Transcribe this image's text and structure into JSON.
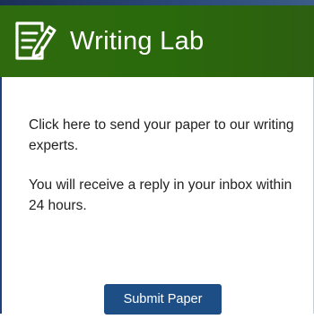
{
  "widget": {
    "title": "Writing Lab",
    "icon": "edit-document-icon",
    "paragraph_1": "Click here to send your paper to our writing experts.",
    "paragraph_2": "You will receive a reply in your inbox within 24 hours.",
    "submit_label": "Submit Paper"
  },
  "colors": {
    "header_bg": "#2f6b0e",
    "button_bg": "#1d4f86",
    "text": "#222222"
  }
}
